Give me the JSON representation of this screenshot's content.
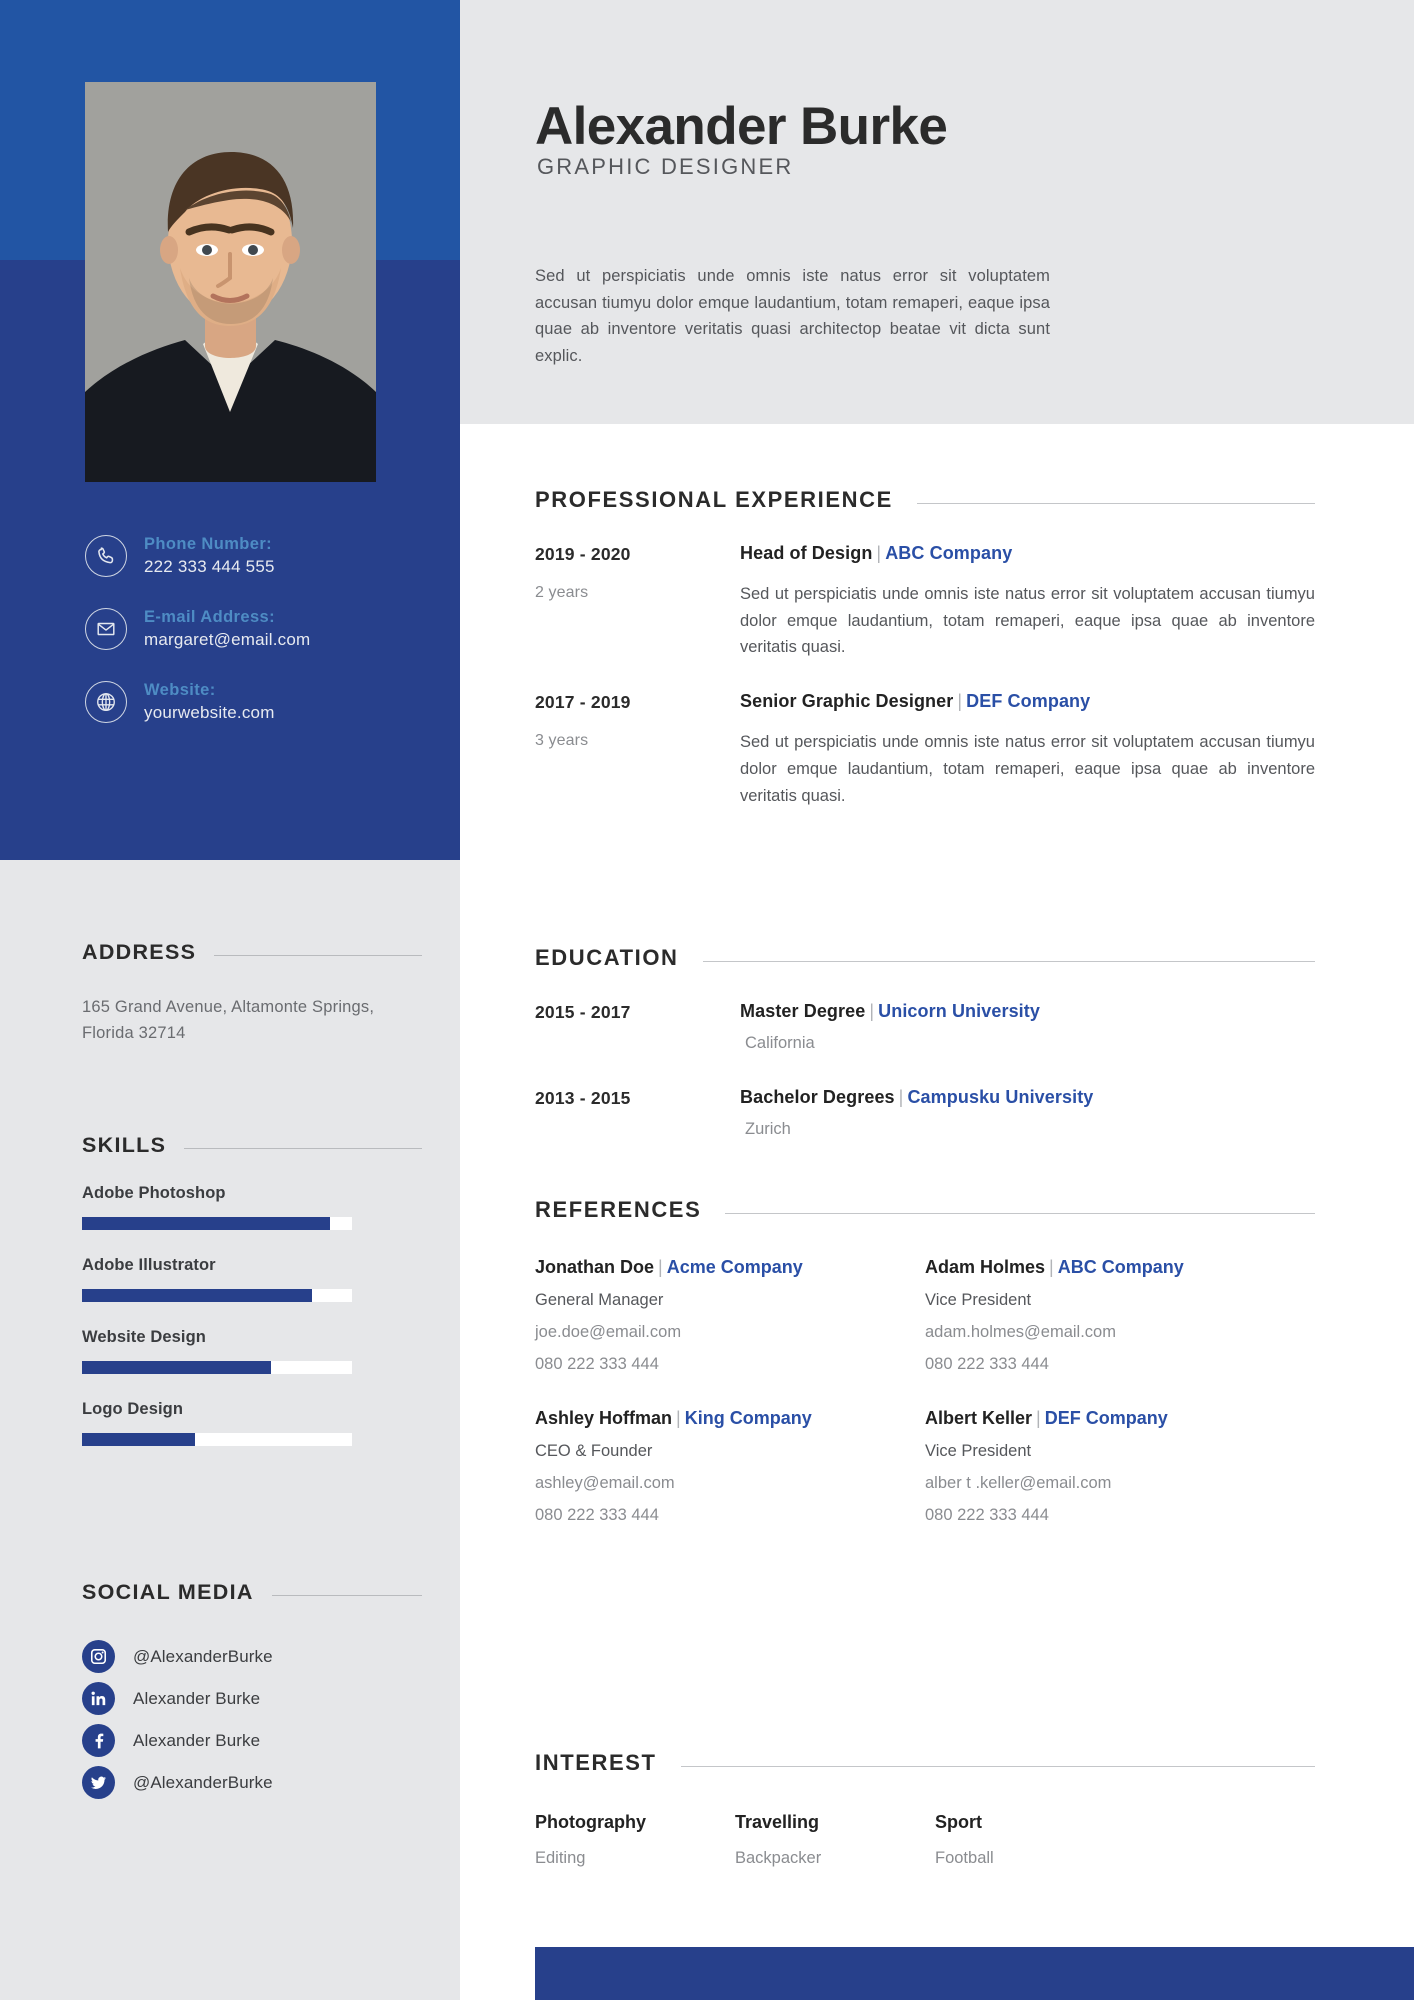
{
  "theme": {
    "blue_top": "#2255a4",
    "blue_main": "#27408b",
    "grey_panel": "#e6e7e9",
    "link_blue": "#2a4fa6",
    "label_blue": "#4e8cc4"
  },
  "header": {
    "name": "Alexander Burke",
    "role": "GRAPHIC DESIGNER",
    "summary": "Sed ut perspiciatis unde omnis iste natus error sit voluptatem accusan tiumyu dolor emque laudantium, totam remaperi, eaque ipsa quae ab inventore veritatis quasi architectop beatae vit dicta sunt explic."
  },
  "contacts": [
    {
      "icon": "phone-icon",
      "label": "Phone  Number:",
      "value": "222 333 444 555"
    },
    {
      "icon": "mail-icon",
      "label": "E-mail Address:",
      "value": "margaret@email.com"
    },
    {
      "icon": "globe-icon",
      "label": "Website:",
      "value": "yourwebsite.com"
    }
  ],
  "address": {
    "title": "ADDRESS",
    "lines": "165 Grand Avenue, Altamonte Springs, Florida 32714"
  },
  "skills": {
    "title": "SKILLS",
    "items": [
      {
        "name": "Adobe Photoshop",
        "percent": 92
      },
      {
        "name": "Adobe Illustrator",
        "percent": 85
      },
      {
        "name": "Website Design",
        "percent": 70
      },
      {
        "name": "Logo Design",
        "percent": 42
      }
    ]
  },
  "social": {
    "title": "SOCIAL MEDIA",
    "items": [
      {
        "icon": "instagram-icon",
        "handle": "@AlexanderBurke"
      },
      {
        "icon": "linkedin-icon",
        "handle": "Alexander Burke"
      },
      {
        "icon": "facebook-icon",
        "handle": "Alexander Burke"
      },
      {
        "icon": "twitter-icon",
        "handle": "@AlexanderBurke"
      }
    ]
  },
  "experience": {
    "title": "PROFESSIONAL EXPERIENCE",
    "items": [
      {
        "years": "2019 - 2020",
        "duration": "2 years",
        "position": "Head of Design",
        "company": "ABC Company",
        "description": "Sed ut perspiciatis unde omnis iste natus error sit voluptatem accusan tiumyu dolor emque laudantium, totam remaperi, eaque ipsa quae ab inventore veritatis quasi."
      },
      {
        "years": "2017 - 2019",
        "duration": "3 years",
        "position": "Senior Graphic Designer",
        "company": "DEF Company",
        "description": "Sed ut perspiciatis unde omnis iste natus error sit voluptatem accusan tiumyu dolor emque laudantium, totam remaperi, eaque ipsa quae ab inventore veritatis quasi."
      }
    ]
  },
  "education": {
    "title": "EDUCATION",
    "items": [
      {
        "years": "2015 - 2017",
        "degree": "Master Degree",
        "school": "Unicorn University",
        "location": "California"
      },
      {
        "years": "2013 - 2015",
        "degree": "Bachelor Degrees",
        "school": "Campusku University",
        "location": "Zurich"
      }
    ]
  },
  "references": {
    "title": "REFERENCES",
    "items": [
      {
        "name": "Jonathan Doe",
        "company": "Acme Company",
        "position": "General Manager",
        "email": "joe.doe@email.com",
        "phone": "080 222 333 444"
      },
      {
        "name": "Adam Holmes",
        "company": "ABC Company",
        "position": "Vice President",
        "email": "adam.holmes@email.com",
        "phone": "080 222 333 444"
      },
      {
        "name": "Ashley Hoffman",
        "company": "King Company",
        "position": "CEO & Founder",
        "email": "ashley@email.com",
        "phone": "080 222 333 444"
      },
      {
        "name": "Albert Keller",
        "company": "DEF Company",
        "position": "Vice President",
        "email": "alber t .keller@email.com",
        "phone": "080 222 333 444"
      }
    ]
  },
  "interest": {
    "title": "INTEREST",
    "items": [
      {
        "name": "Photography",
        "sub": "Editing"
      },
      {
        "name": "Travelling",
        "sub": "Backpacker"
      },
      {
        "name": "Sport",
        "sub": "Football"
      }
    ]
  }
}
